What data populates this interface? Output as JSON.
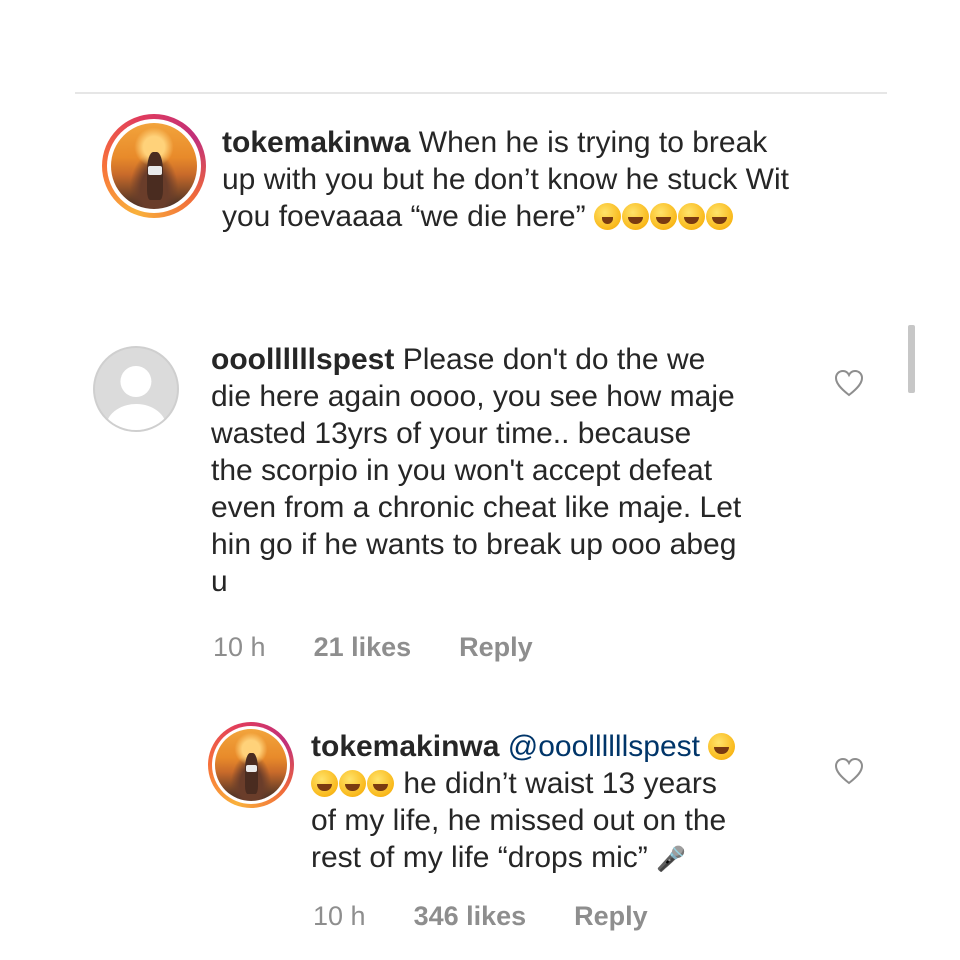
{
  "comments": [
    {
      "username": "tokemakinwa",
      "line1": " When he is trying to break",
      "line2": "up with you but he don’t know he stuck Wit",
      "line3": "you foevaaaa “we die here” ",
      "emojis": [
        "winking-tongue-emoji",
        "laughing-emoji",
        "laughing-emoji",
        "laughing-emoji",
        "laughing-emoji"
      ]
    },
    {
      "username": "ooollllllspest",
      "line1": " Please don't do the we",
      "line2": "die here again oooo, you see how maje",
      "line3": "wasted 13yrs of your time.. because",
      "line4": "the scorpio in you won't accept defeat",
      "line5": "even from a chronic cheat like maje. Let",
      "line6": "hin go if he wants to break up ooo abeg",
      "line7": "u",
      "time": "10 h",
      "likes": "21 likes",
      "reply": "Reply"
    },
    {
      "username": "tokemakinwa",
      "mention": "@ooollllllspest",
      "line2": " he didn’t waist 13 years",
      "line3": "of my life, he missed out on the",
      "line4": "rest of my life “drops mic” ",
      "mic_glyph": "🎤",
      "time": "10 h",
      "likes": "346 likes",
      "reply": "Reply"
    }
  ],
  "icons": {
    "like": "heart-outline-icon",
    "scroll": "scrollbar-thumb"
  }
}
